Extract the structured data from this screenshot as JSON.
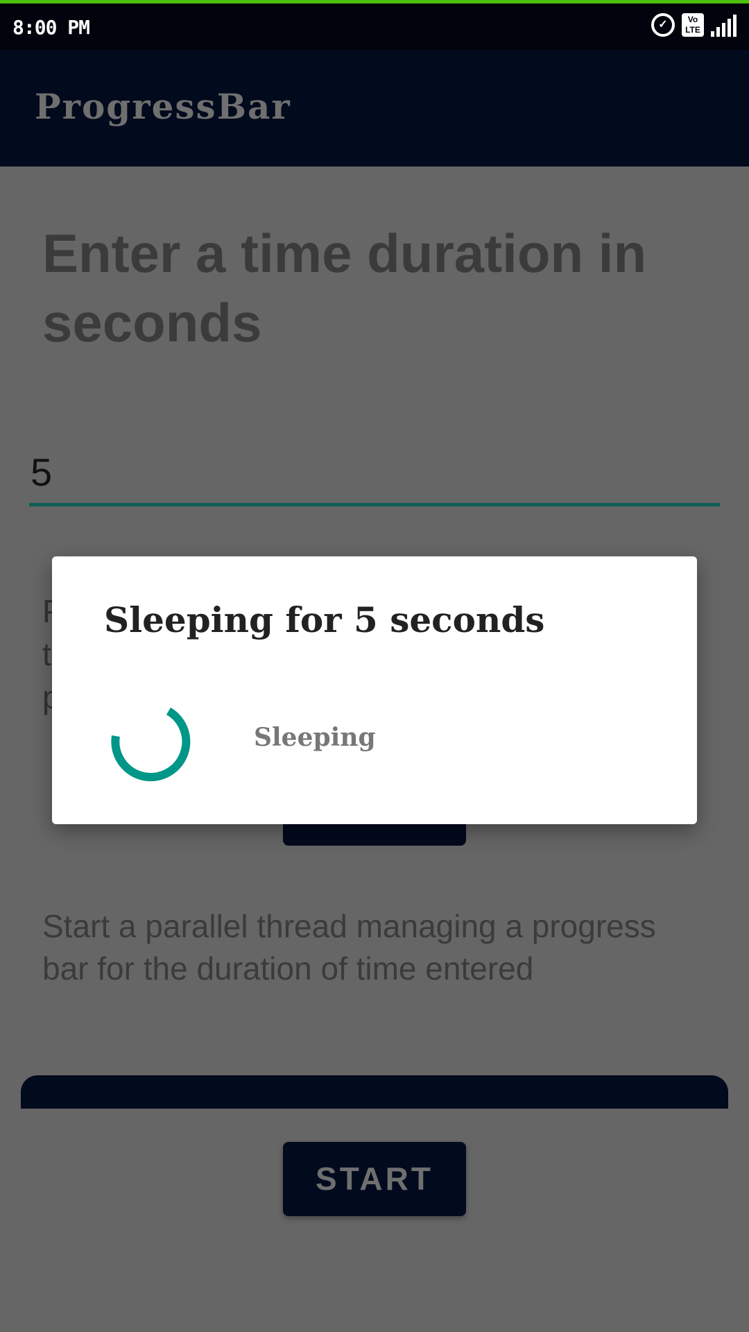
{
  "status_bar": {
    "time": "8:00 PM",
    "volte": "Vo LTE",
    "icons": [
      "alarm-icon",
      "volte-icon",
      "signal-icon"
    ]
  },
  "app_bar": {
    "title": "ProgressBar"
  },
  "main": {
    "heading": "Enter a time duration in seconds",
    "duration_input": {
      "value": "5"
    },
    "hidden_text_lines": [
      "P",
      "t",
      "p"
    ],
    "description": "Start a parallel thread managing a progress bar for the duration of time entered",
    "progress": {
      "value": 0
    },
    "start_label": "START"
  },
  "dialog": {
    "title": "Sleeping for 5 seconds",
    "message": "Sleeping"
  },
  "colors": {
    "accent": "#009688",
    "primary": "#020a1d",
    "status_line": "#4cc20e"
  }
}
